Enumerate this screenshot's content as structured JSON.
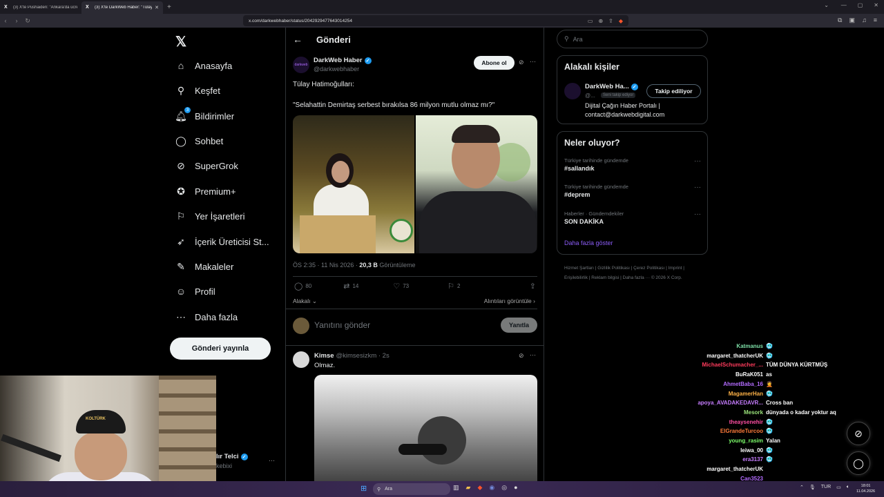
{
  "browser": {
    "tabs": [
      {
        "title": "(3) X'te Pushaiden: \"Ankara'da ücreti...",
        "active": false
      },
      {
        "title": "(3) X'te DarkWeb Haber: \"Tülay Hatim...",
        "active": true
      }
    ],
    "new_tab": "+",
    "url": "x.com/darkwebhaber/status/2042929477643014254"
  },
  "nav": {
    "logo": "𝕏",
    "items": [
      {
        "label": "Anasayfa",
        "icon": "home-icon"
      },
      {
        "label": "Keşfet",
        "icon": "search-icon"
      },
      {
        "label": "Bildirimler",
        "icon": "bell-icon",
        "badge": "3"
      },
      {
        "label": "Sohbet",
        "icon": "chat-icon"
      },
      {
        "label": "SuperGrok",
        "icon": "grok-icon"
      },
      {
        "label": "Premium+",
        "icon": "premium-icon"
      },
      {
        "label": "Yer İşaretleri",
        "icon": "bookmark-icon"
      },
      {
        "label": "İçerik Üreticisi St...",
        "icon": "rocket-icon"
      },
      {
        "label": "Makaleler",
        "icon": "article-icon"
      },
      {
        "label": "Profil",
        "icon": "profile-icon"
      },
      {
        "label": "Daha fazla",
        "icon": "more-circle-icon"
      }
    ],
    "post_button": "Gönderi yayınla"
  },
  "main": {
    "header_title": "Gönderi",
    "tweet": {
      "author_name": "DarkWeb Haber",
      "author_handle": "@darkwebhaber",
      "avatar_text": "darkweb",
      "follow_label": "Abone ol",
      "line1": "Tülay Hatimoğulları:",
      "line2": "\"Selahattin Demirtaş serbest bırakılsa 86 milyon mutlu olmaz mı?\"",
      "time": "ÖS 2:35 · 11 Nis 2026 · ",
      "views": "20,3 B",
      "views_label": " Görüntüleme",
      "replies": "80",
      "reposts": "14",
      "likes": "73",
      "bookmarks": "2",
      "sort_label": "Alakalı",
      "quotes_label": "Alıntıları görüntüle"
    },
    "reply_box": {
      "placeholder": "Yanıtını gönder",
      "button": "Yanıtla"
    },
    "reply": {
      "author_name": "Kimse",
      "author_handle": "@kimsesizkm · 2s",
      "text": "Olmaz."
    }
  },
  "sidebar": {
    "search_placeholder": "Ara",
    "relevant_people": {
      "title": "Alakalı kişiler",
      "name": "DarkWeb Ha...",
      "handle": "@...",
      "follows_you": "Seni takip ediyor",
      "button": "Takip ediliyor",
      "bio_line1": "Dijital Çağın Haber Portalı |",
      "bio_line2": "contact@darkwebdigital.com"
    },
    "trends": {
      "title": "Neler oluyor?",
      "items": [
        {
          "context": "Türkiye tarihinde gündemde",
          "name": "#sallandık"
        },
        {
          "context": "Türkiye tarihinde gündemde",
          "name": "#deprem"
        },
        {
          "context": "Haberler · Gündemdekiler",
          "name": "SON DAKİKA"
        }
      ],
      "show_more": "Daha fazla göster"
    },
    "footer": "Hizmet Şartları  |  Gizlilik Politikası  |  Çerez Politikası  |  Imprint  |  Erişilebilirlik  |  Reklam bilgisi  |  Daha fazla ···  © 2026 X Corp."
  },
  "peek_author": {
    "name": "lır Telci",
    "handle": "kebixi"
  },
  "webcam": {
    "cap_text": "KOLTÜRK"
  },
  "chat": [
    {
      "user": "Katmanus",
      "color": "#7ee0a8",
      "msg": "🥶"
    },
    {
      "user": "margaret_thatcherUK",
      "color": "#ffffff",
      "msg": "🥶"
    },
    {
      "user": "MichaelSchumacher_...",
      "color": "#ff3b5c",
      "msg": "TÜM DÜNYA KÜRTMÜŞ"
    },
    {
      "user": "BuRaK051",
      "color": "#ffffff",
      "msg": "as"
    },
    {
      "user": "AhmetBaba_16",
      "color": "#b36bff",
      "msg": "🤦"
    },
    {
      "user": "MagamerHan",
      "color": "#ffb347",
      "msg": "🥶"
    },
    {
      "user": "apoya_AVADAKEDAVR...",
      "color": "#c77dff",
      "msg": "Cross ban"
    },
    {
      "user": "Mesork",
      "color": "#9be37b",
      "msg": "dünyada o kadar yoktur aq"
    },
    {
      "user": "theaysenehir",
      "color": "#ff4fa3",
      "msg": "🥶"
    },
    {
      "user": "ElGrandeTurcoo",
      "color": "#ff7b3a",
      "msg": "🥶"
    },
    {
      "user": "young_rasim",
      "color": "#7dff6b",
      "msg": "Yalan"
    },
    {
      "user": "leiwa_00",
      "color": "#ffffff",
      "msg": "🥶"
    },
    {
      "user": "era3137",
      "color": "#c77dff",
      "msg": "🥶"
    },
    {
      "user": "margaret_thatcherUK",
      "color": "#ffffff",
      "msg": ""
    },
    {
      "user": "Can3523",
      "color": "#b36bff",
      "msg": ""
    }
  ],
  "taskbar": {
    "search": "Ara",
    "lang": "TUR",
    "time": "18:01",
    "date": "11.04.2026"
  }
}
